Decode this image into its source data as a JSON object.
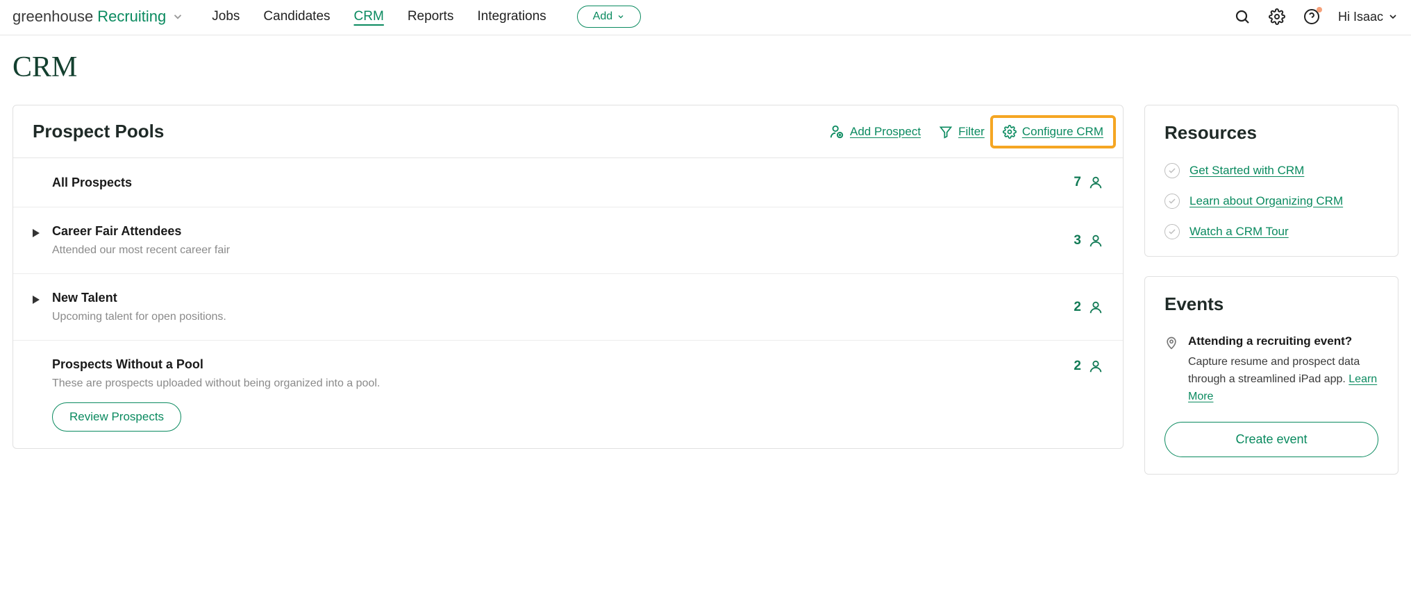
{
  "brand": {
    "text1": "greenhouse",
    "text2": "Recruiting"
  },
  "nav": {
    "items": [
      "Jobs",
      "Candidates",
      "CRM",
      "Reports",
      "Integrations"
    ],
    "active_index": 2,
    "add_label": "Add"
  },
  "user": {
    "greeting": "Hi Isaac"
  },
  "page": {
    "title": "CRM"
  },
  "pool_panel": {
    "title": "Prospect Pools",
    "actions": {
      "add_prospect": "Add Prospect",
      "filter": "Filter",
      "configure": "Configure CRM"
    },
    "rows": [
      {
        "name": "All Prospects",
        "desc": "",
        "count": 7,
        "has_caret": false,
        "review": false
      },
      {
        "name": "Career Fair Attendees",
        "desc": "Attended our most recent career fair",
        "count": 3,
        "has_caret": true,
        "review": false
      },
      {
        "name": "New Talent",
        "desc": "Upcoming talent for open positions.",
        "count": 2,
        "has_caret": true,
        "review": false
      },
      {
        "name": "Prospects Without a Pool",
        "desc": "These are prospects uploaded without being organized into a pool.",
        "count": 2,
        "has_caret": false,
        "review": true
      }
    ],
    "review_label": "Review Prospects"
  },
  "resources": {
    "title": "Resources",
    "items": [
      "Get Started with CRM",
      "Learn about Organizing CRM",
      "Watch a CRM Tour"
    ]
  },
  "events": {
    "title": "Events",
    "heading": "Attending a recruiting event?",
    "body": "Capture resume and prospect data through a streamlined iPad app.  ",
    "learn_more": "Learn More",
    "create_label": "Create event"
  }
}
